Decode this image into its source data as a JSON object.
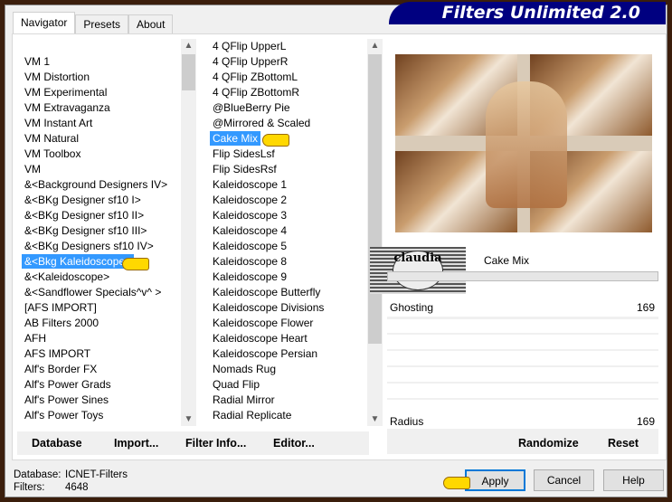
{
  "title": "Filters Unlimited 2.0",
  "tabs": [
    {
      "label": "Navigator",
      "active": true
    },
    {
      "label": "Presets"
    },
    {
      "label": "About"
    }
  ],
  "categories": [
    "VM 1",
    "VM Distortion",
    "VM Experimental",
    "VM Extravaganza",
    "VM Instant Art",
    "VM Natural",
    "VM Toolbox",
    "VM",
    "&<Background Designers IV>",
    "&<BKg Designer sf10 I>",
    "&<BKg Designer sf10 II>",
    "&<BKg Designer sf10 III>",
    "&<BKg Designers sf10 IV>",
    "&<Bkg Kaleidoscope>",
    "&<Kaleidoscope>",
    "&<Sandflower Specials^v^ >",
    "[AFS IMPORT]",
    "AB Filters 2000",
    "AFH",
    "AFS IMPORT",
    "Alf's Border FX",
    "Alf's Power Grads",
    "Alf's Power Sines",
    "Alf's Power Toys"
  ],
  "selected_category": "&<Bkg Kaleidoscope>",
  "filters": [
    "4 QFlip UpperL",
    "4 QFlip UpperR",
    "4 QFlip ZBottomL",
    "4 QFlip ZBottomR",
    "@BlueBerry Pie",
    "@Mirrored & Scaled",
    "Cake Mix",
    "Flip SidesLsf",
    "Flip SidesRsf",
    "Kaleidoscope 1",
    "Kaleidoscope 2",
    "Kaleidoscope 3",
    "Kaleidoscope 4",
    "Kaleidoscope 5",
    "Kaleidoscope 8",
    "Kaleidoscope 9",
    "Kaleidoscope Butterfly",
    "Kaleidoscope Divisions",
    "Kaleidoscope Flower",
    "Kaleidoscope Heart",
    "Kaleidoscope Persian",
    "Nomads Rug",
    "Quad Flip",
    "Radial Mirror",
    "Radial Replicate"
  ],
  "selected_filter": "Cake Mix",
  "list_buttons": {
    "database": "Database",
    "import": "Import...",
    "filter_info": "Filter Info...",
    "editor": "Editor..."
  },
  "filter_name": "Cake Mix",
  "watermark": "claudia",
  "params": [
    {
      "label": "Ghosting",
      "value": "169"
    },
    {
      "label": "Radius",
      "value": "169"
    }
  ],
  "randomize": "Randomize",
  "reset": "Reset",
  "status": {
    "database_label": "Database:",
    "database_value": "ICNET-Filters",
    "filters_label": "Filters:",
    "filters_value": "4648"
  },
  "buttons": {
    "apply": "Apply",
    "cancel": "Cancel",
    "help": "Help"
  }
}
